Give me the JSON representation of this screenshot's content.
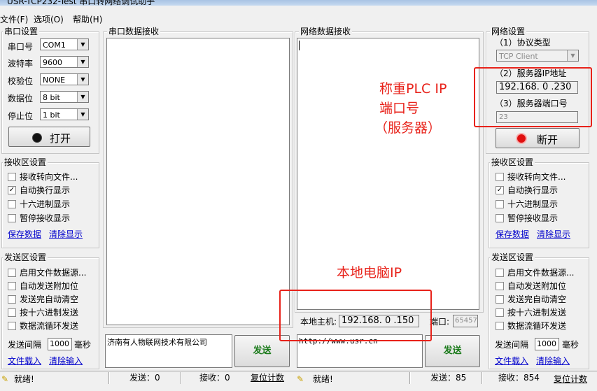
{
  "window": {
    "title": "USR-TCP232-Test 串口转网络调试助手"
  },
  "menu": {
    "file": "文件(F)",
    "options": "选项(O)",
    "help": "帮助(H)"
  },
  "serial_settings": {
    "title": "串口设置",
    "port_label": "串口号",
    "port_value": "COM1",
    "baud_label": "波特率",
    "baud_value": "9600",
    "parity_label": "校验位",
    "parity_value": "NONE",
    "data_bits_label": "数据位",
    "data_bits_value": "8 bit",
    "stop_bits_label": "停止位",
    "stop_bits_value": "1 bit",
    "open_button": "打开"
  },
  "serial_receive": {
    "title": "串口数据接收"
  },
  "network_receive": {
    "title": "网络数据接收"
  },
  "network_settings": {
    "title": "网络设置",
    "protocol_label": "（1）协议类型",
    "protocol_value": "TCP Client",
    "ip_label": "（2）服务器IP地址",
    "ip_value": "192.168. 0 .230",
    "port_label": "（3）服务器端口号",
    "port_value": "23",
    "disconnect_button": "断开"
  },
  "left_recv_settings": {
    "title": "接收区设置",
    "opt1": "接收转向文件...",
    "opt2": "自动换行显示",
    "opt3": "十六进制显示",
    "opt4": "暂停接收显示",
    "save": "保存数据",
    "clear": "清除显示"
  },
  "left_send_settings": {
    "title": "发送区设置",
    "opt1": "启用文件数据源...",
    "opt2": "自动发送附加位",
    "opt3": "发送完自动清空",
    "opt4": "按十六进制发送",
    "opt5": "数据流循环发送",
    "interval_label": "发送间隔",
    "interval_value": "1000",
    "interval_unit": "毫秒",
    "load": "文件载入",
    "clear": "清除输入"
  },
  "right_recv_settings": {
    "title": "接收区设置",
    "opt1": "接收转向文件...",
    "opt2": "自动换行显示",
    "opt3": "十六进制显示",
    "opt4": "暂停接收显示",
    "save": "保存数据",
    "clear": "清除显示"
  },
  "right_send_settings": {
    "title": "发送区设置",
    "opt1": "启用文件数据源...",
    "opt2": "自动发送附加位",
    "opt3": "发送完自动清空",
    "opt4": "按十六进制发送",
    "opt5": "数据流循环发送",
    "interval_label": "发送间隔",
    "interval_value": "1000",
    "interval_unit": "毫秒",
    "load": "文件载入",
    "clear": "清除输入"
  },
  "local_host": {
    "label": "本地主机:",
    "ip": "192.168. 0 .150",
    "port_label": "端口:",
    "port_value": "65457"
  },
  "serial_send": {
    "text": "济南有人物联网技术有限公司",
    "button": "发送"
  },
  "network_send": {
    "text": "http://www.usr.cn",
    "button": "发送"
  },
  "status_left": {
    "ready": "就绪!",
    "sent": "发送：0",
    "recv": "接收：0",
    "reset": "复位计数"
  },
  "status_right": {
    "ready": "就绪!",
    "sent": "发送：85",
    "recv": "接收：854",
    "reset": "复位计数"
  },
  "annotations": {
    "plc_line1": "称重PLC IP",
    "plc_line2": "端口号",
    "plc_line3": "（服务器）",
    "local_pc": "本地电脑IP"
  },
  "colors": {
    "annotation_red": "#e8221a",
    "link_blue": "#0000cc",
    "send_green": "#1a7a1a"
  }
}
